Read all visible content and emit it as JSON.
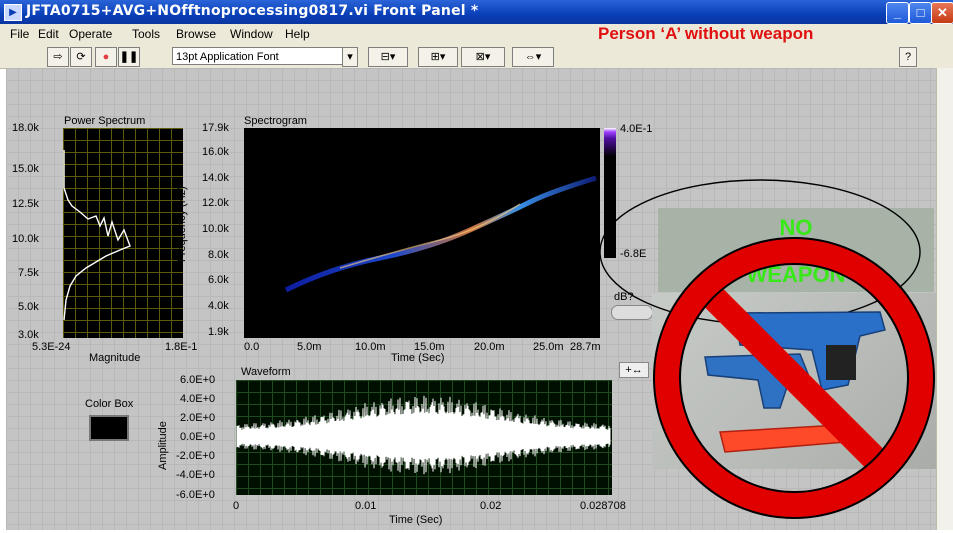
{
  "window": {
    "title": "JFTA0715+AVG+NOfftnoprocessing0817.vi Front Panel *",
    "min_glyph": "_",
    "max_glyph": "□",
    "close_glyph": "✕"
  },
  "menu": [
    "File",
    "Edit",
    "Operate",
    "Tools",
    "Browse",
    "Window",
    "Help"
  ],
  "toolbar": {
    "font": "13pt Application Font",
    "help": "?"
  },
  "overlay_title": "Person ‘A’ without weapon",
  "power_spectrum": {
    "title": "Power Spectrum",
    "y_ticks": [
      "18.0k",
      "15.0k",
      "12.5k",
      "10.0k",
      "7.5k",
      "5.0k",
      "3.0k"
    ],
    "x_ticks": [
      "5.3E-24",
      "1.8E-1"
    ],
    "xlabel": "Magnitude"
  },
  "spectrogram": {
    "title": "Spectrogram",
    "ylabel": "Frequency (Hz)",
    "y_ticks": [
      "17.9k",
      "16.0k",
      "14.0k",
      "12.0k",
      "10.0k",
      "8.0k",
      "6.0k",
      "4.0k",
      "1.9k"
    ],
    "x_ticks": [
      "0.0",
      "5.0m",
      "10.0m",
      "15.0m",
      "20.0m",
      "25.0m",
      "28.7m"
    ],
    "xlabel": "Time (Sec)",
    "colorbar_max": "4.0E-1",
    "colorbar_min": "-6.8E",
    "db_label": "dB?"
  },
  "waveform": {
    "title": "Waveform",
    "ylabel": "Amplitude",
    "y_ticks": [
      "6.0E+0",
      "4.0E+0",
      "2.0E+0",
      "0.0E+0",
      "-2.0E+0",
      "-4.0E+0",
      "-6.0E+0"
    ],
    "x_ticks": [
      "0",
      "0.01",
      "0.02",
      "0.028708"
    ],
    "xlabel": "Time (Sec)"
  },
  "color_box_label": "Color Box",
  "no_weapon": {
    "line1": "NO",
    "line2": "WEAPON"
  },
  "colors": {
    "titlebar": "#0a3fb8",
    "overlay_text": "#e01010",
    "no_weapon_text": "#38e818",
    "prohibit": "#e00000"
  }
}
